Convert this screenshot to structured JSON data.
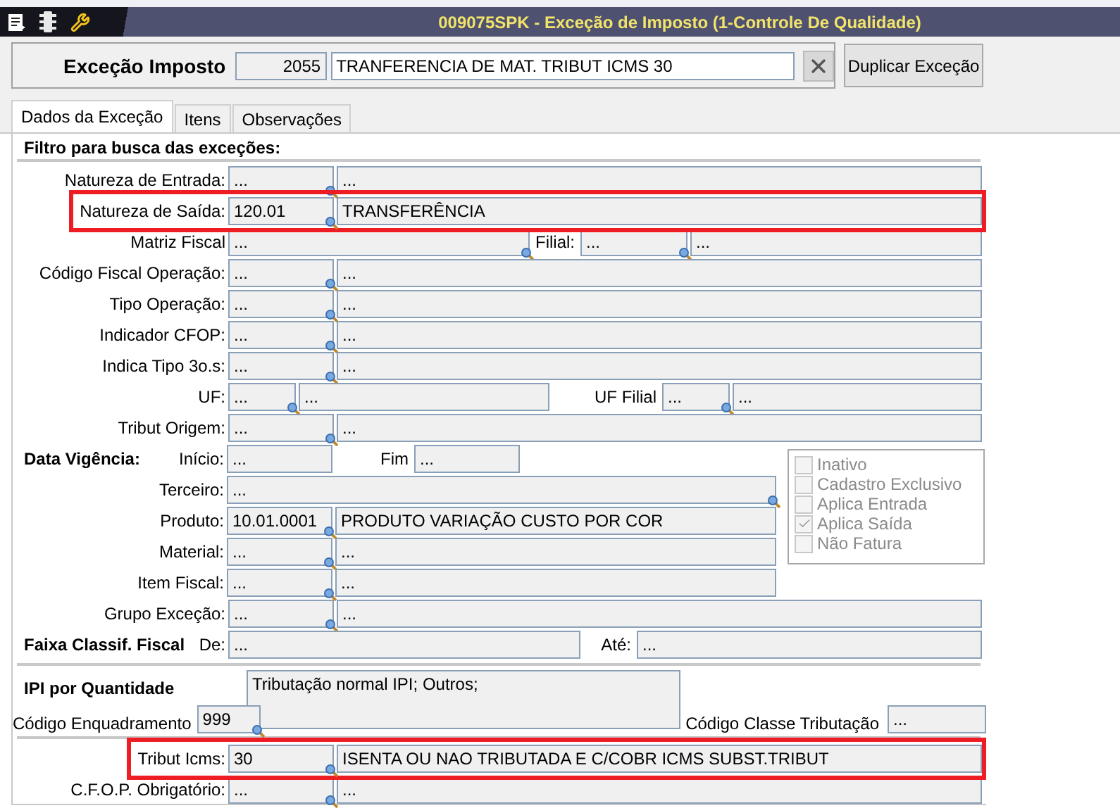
{
  "window": {
    "title": "009075SPK - Exceção de Imposto (1-Controle De Qualidade)"
  },
  "header": {
    "label": "Exceção Imposto",
    "code": "2055",
    "description": "TRANFERENCIA DE MAT. TRIBUT ICMS 30",
    "action_button": "Duplicar Exceção"
  },
  "tabs": [
    {
      "label": "Dados da Exceção",
      "selected": true
    },
    {
      "label": "Itens",
      "selected": false
    },
    {
      "label": "Observações",
      "selected": false
    }
  ],
  "filter": {
    "title": "Filtro para busca das exceções:",
    "rows": [
      {
        "kind": "pair",
        "label": "Natureza de Entrada:",
        "values": [
          "...",
          "..."
        ],
        "highlighted": false
      },
      {
        "kind": "pair",
        "label": "Natureza de Saída:",
        "values": [
          "120.01",
          "TRANSFERÊNCIA"
        ],
        "highlighted": true
      },
      {
        "kind": "matriz",
        "label": "Matriz Fiscal",
        "sublabel": "Filial:",
        "values": [
          "...",
          "...",
          "..."
        ],
        "highlighted": false
      },
      {
        "kind": "pair",
        "label": "Código Fiscal Operação:",
        "values": [
          "...",
          "..."
        ],
        "highlighted": false
      },
      {
        "kind": "pair",
        "label": "Tipo Operação:",
        "values": [
          "...",
          "..."
        ],
        "highlighted": false
      },
      {
        "kind": "pair",
        "label": "Indicador CFOP:",
        "values": [
          "...",
          "..."
        ],
        "highlighted": false
      },
      {
        "kind": "pair",
        "label": "Indica Tipo 3o.s:",
        "values": [
          "...",
          "..."
        ],
        "highlighted": false
      },
      {
        "kind": "uf",
        "label": "UF:",
        "sublabel": "UF Filial",
        "values": [
          "...",
          "...",
          "...",
          "..."
        ],
        "highlighted": false
      },
      {
        "kind": "pair",
        "label": "Tribut Origem:",
        "values": [
          "...",
          "..."
        ],
        "highlighted": false
      }
    ],
    "dated_rows": [
      {
        "kind": "dates",
        "section": "Data Vigência:",
        "label": "Início:",
        "sublabel": "Fim",
        "values": [
          "...",
          "..."
        ],
        "highlighted": false
      },
      {
        "kind": "single",
        "label": "Terceiro:",
        "values": [
          "..."
        ],
        "highlighted": false
      },
      {
        "kind": "pair",
        "label": "Produto:",
        "values": [
          "10.01.0001",
          "PRODUTO VARIAÇÃO CUSTO POR COR"
        ],
        "highlighted": false
      },
      {
        "kind": "pair",
        "label": "Material:",
        "values": [
          "...",
          "..."
        ],
        "highlighted": false
      },
      {
        "kind": "pair",
        "label": "Item Fiscal:",
        "values": [
          "...",
          "..."
        ],
        "highlighted": false
      }
    ],
    "checkboxes": [
      {
        "label": "Inativo",
        "checked": false,
        "disabled": true
      },
      {
        "label": "Cadastro Exclusivo",
        "checked": false,
        "disabled": true
      },
      {
        "label": "Aplica Entrada",
        "checked": false,
        "disabled": true
      },
      {
        "label": "Aplica Saída",
        "checked": true,
        "disabled": true
      },
      {
        "label": "Não Fatura",
        "checked": false,
        "disabled": true
      }
    ],
    "more_rows": [
      {
        "kind": "pair",
        "label": "Grupo Exceção:",
        "values": [
          "...",
          "..."
        ],
        "highlighted": false
      },
      {
        "kind": "range",
        "section": "Faixa Classif. Fiscal",
        "label": "De:",
        "sublabel": "Até:",
        "values": [
          "...",
          "..."
        ],
        "highlighted": false
      }
    ]
  },
  "ipi": {
    "title": "IPI por Quantidade",
    "description": "Tributação normal IPI; Outros;",
    "code_label": "Código Enquadramento",
    "code": "999",
    "class_label": "Código Classe Tributação",
    "class_value": "..."
  },
  "tax_rows": [
    {
      "kind": "pair",
      "label": "Tribut Icms:",
      "values": [
        "30",
        "ISENTA OU NAO TRIBUTADA E C/COBR ICMS SUBST.TRIBUT"
      ],
      "highlighted": true
    },
    {
      "kind": "pair",
      "label": "C.F.O.P. Obrigatório:",
      "values": [
        "...",
        "..."
      ],
      "highlighted": false
    }
  ]
}
